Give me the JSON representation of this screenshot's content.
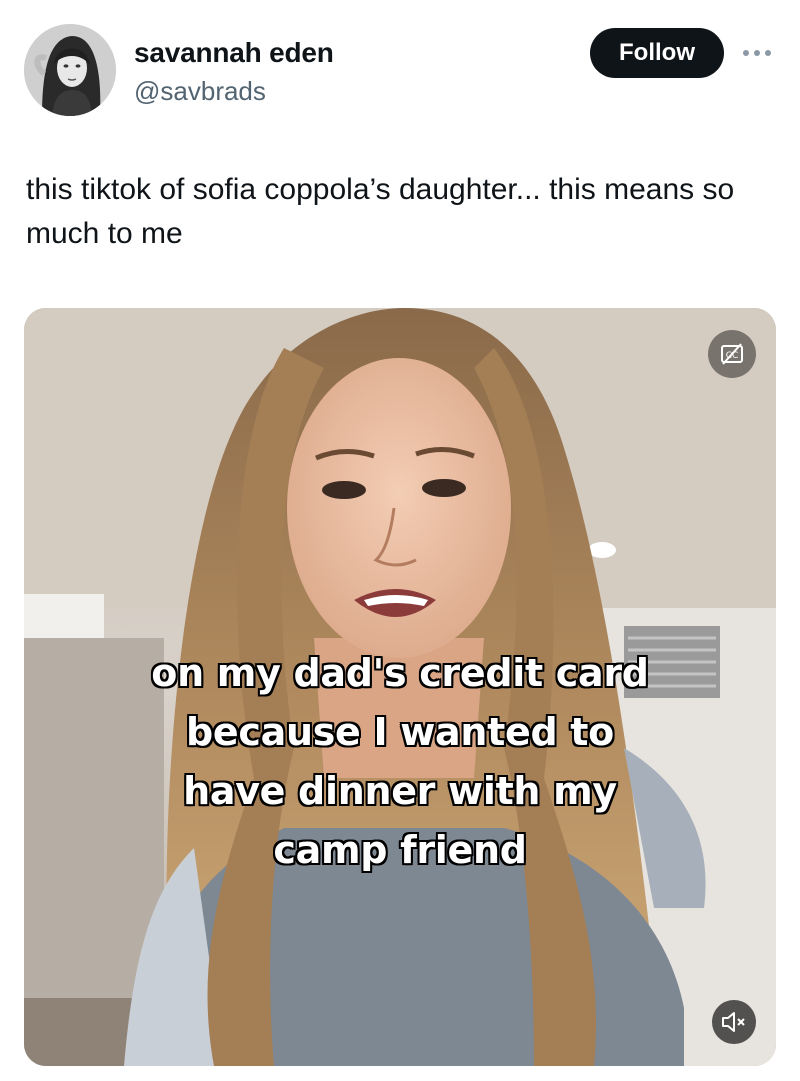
{
  "post": {
    "author": {
      "display_name": "savannah eden",
      "handle": "@savbrads"
    },
    "follow_label": "Follow",
    "more_icon": "more-horizontal-icon",
    "text": "this tiktok of sofia coppola’s daughter... this means so much to me"
  },
  "media": {
    "caption_lines": [
      "on my dad's credit card",
      "because I wanted to",
      "have dinner with my",
      "camp friend"
    ],
    "captions_icon": "captions-off-icon",
    "mute_icon": "volume-muted-icon"
  },
  "colors": {
    "follow_bg": "#0f1419",
    "handle_text": "#536471",
    "text": "#0f1419"
  }
}
